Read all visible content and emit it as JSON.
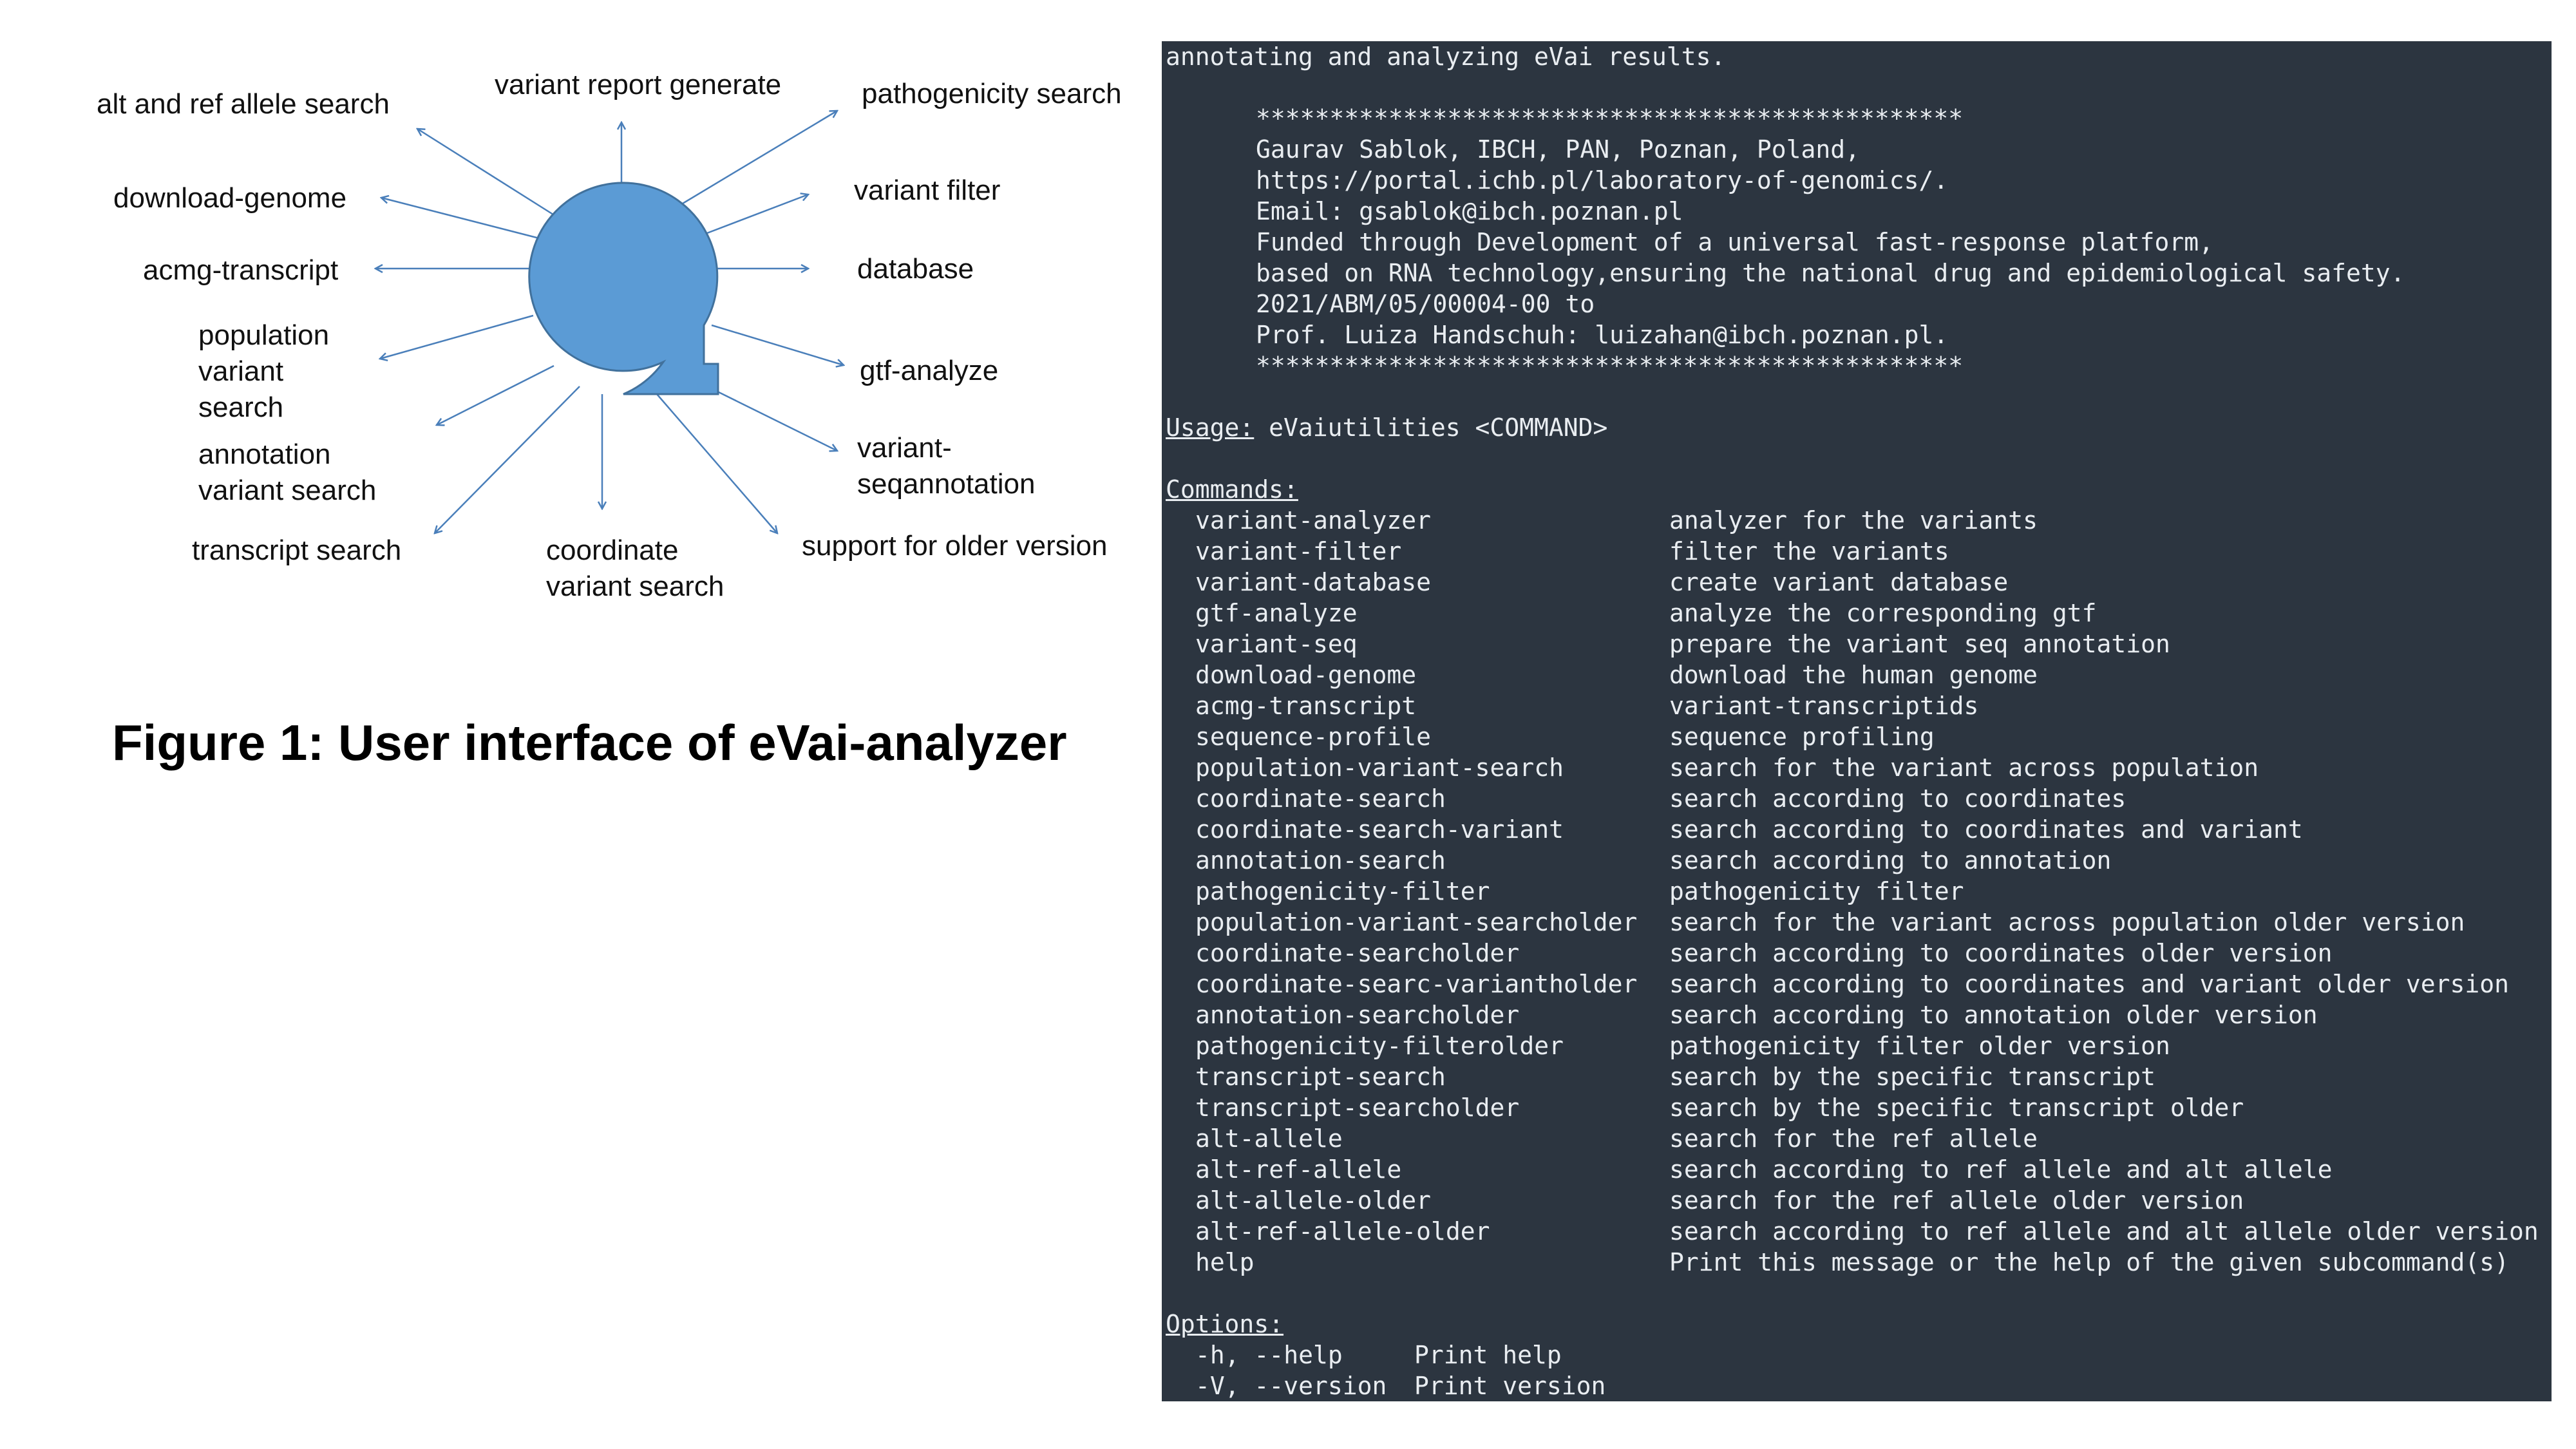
{
  "diagram": {
    "hub_color": "#5b9bd5",
    "arrow_color": "#4a7fba",
    "labels": {
      "alt_ref": "alt and ref allele search",
      "report": "variant report generate",
      "pathogenicity": "pathogenicity search",
      "download": "download-genome",
      "filter": "variant filter",
      "acmg": "acmg-transcript",
      "database": "database",
      "population": "population\nvariant\nsearch",
      "gtf": "gtf-analyze",
      "annotation": "annotation\nvariant search",
      "seqannotation": "variant-\nseqannotation",
      "transcript": "transcript search",
      "coordinate": "coordinate\nvariant search",
      "older": "support for older version"
    }
  },
  "caption": "Figure 1: User interface of eVai-analyzer",
  "terminal": {
    "background": "#2c3540",
    "intro": "annotating and analyzing eVai results.",
    "banner": [
      "************************************************",
      "Gaurav Sablok, IBCH, PAN, Poznan, Poland,",
      "https://portal.ichb.pl/laboratory-of-genomics/.",
      "Email: gsablok@ibch.poznan.pl",
      "Funded through Development of a universal fast-response platform,",
      "based on RNA technology,ensuring the national drug and epidemiological safety.",
      "2021/ABM/05/00004-00 to",
      "Prof. Luiza Handschuh: luizahan@ibch.poznan.pl.",
      "************************************************"
    ],
    "usage_label": "Usage:",
    "usage_value": " eVaiutilities <COMMAND>",
    "commands_label": "Commands:",
    "commands": [
      {
        "name": "variant-analyzer",
        "desc": "analyzer for the variants"
      },
      {
        "name": "variant-filter",
        "desc": "filter the variants"
      },
      {
        "name": "variant-database",
        "desc": "create variant database"
      },
      {
        "name": "gtf-analyze",
        "desc": "analyze the corresponding gtf"
      },
      {
        "name": "variant-seq",
        "desc": "prepare the variant seq annotation"
      },
      {
        "name": "download-genome",
        "desc": "download the human genome"
      },
      {
        "name": "acmg-transcript",
        "desc": "variant-transcriptids"
      },
      {
        "name": "sequence-profile",
        "desc": "sequence profiling"
      },
      {
        "name": "population-variant-search",
        "desc": "search for the variant across population"
      },
      {
        "name": "coordinate-search",
        "desc": "search according to coordinates"
      },
      {
        "name": "coordinate-search-variant",
        "desc": "search according to coordinates and variant"
      },
      {
        "name": "annotation-search",
        "desc": "search according to annotation"
      },
      {
        "name": "pathogenicity-filter",
        "desc": "pathogenicity filter"
      },
      {
        "name": "population-variant-searcholder",
        "desc": "search for the variant across population older version"
      },
      {
        "name": "coordinate-searcholder",
        "desc": "search according to coordinates older version"
      },
      {
        "name": "coordinate-searc-variantholder",
        "desc": "search according to coordinates and variant older version"
      },
      {
        "name": "annotation-searcholder",
        "desc": "search according to annotation older version"
      },
      {
        "name": "pathogenicity-filterolder",
        "desc": "pathogenicity filter older version"
      },
      {
        "name": "transcript-search",
        "desc": "search by the specific transcript"
      },
      {
        "name": "transcript-searcholder",
        "desc": "search by the specific transcript older"
      },
      {
        "name": "alt-allele",
        "desc": "search for the ref allele"
      },
      {
        "name": "alt-ref-allele",
        "desc": "search according to ref allele and alt allele"
      },
      {
        "name": "alt-allele-older",
        "desc": "search for the ref allele older version"
      },
      {
        "name": "alt-ref-allele-older",
        "desc": "search according to ref allele and alt allele older version"
      },
      {
        "name": "help",
        "desc": "Print this message or the help of the given subcommand(s)"
      }
    ],
    "options_label": "Options:",
    "options": [
      {
        "flag": "-h, --help",
        "desc": "Print help"
      },
      {
        "flag": "-V, --version",
        "desc": "Print version"
      }
    ]
  }
}
